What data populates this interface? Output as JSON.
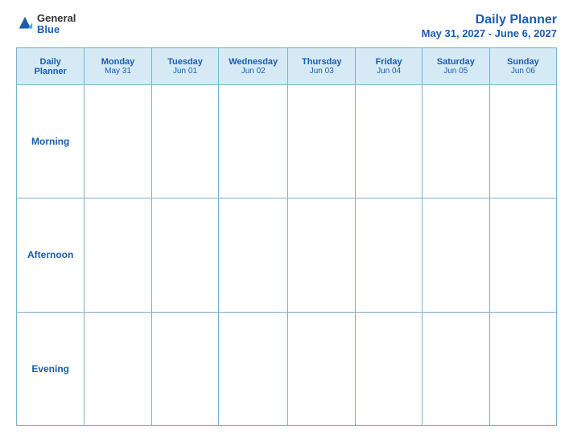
{
  "header": {
    "logo": {
      "general": "General",
      "blue": "Blue"
    },
    "title": "Daily Planner",
    "subtitle": "May 31, 2027 - June 6, 2027"
  },
  "table": {
    "columns": [
      {
        "label": "Daily\nPlanner",
        "date": ""
      },
      {
        "label": "Monday",
        "date": "May 31"
      },
      {
        "label": "Tuesday",
        "date": "Jun 01"
      },
      {
        "label": "Wednesday",
        "date": "Jun 02"
      },
      {
        "label": "Thursday",
        "date": "Jun 03"
      },
      {
        "label": "Friday",
        "date": "Jun 04"
      },
      {
        "label": "Saturday",
        "date": "Jun 05"
      },
      {
        "label": "Sunday",
        "date": "Jun 06"
      }
    ],
    "rows": [
      {
        "label": "Morning"
      },
      {
        "label": "Afternoon"
      },
      {
        "label": "Evening"
      }
    ]
  }
}
